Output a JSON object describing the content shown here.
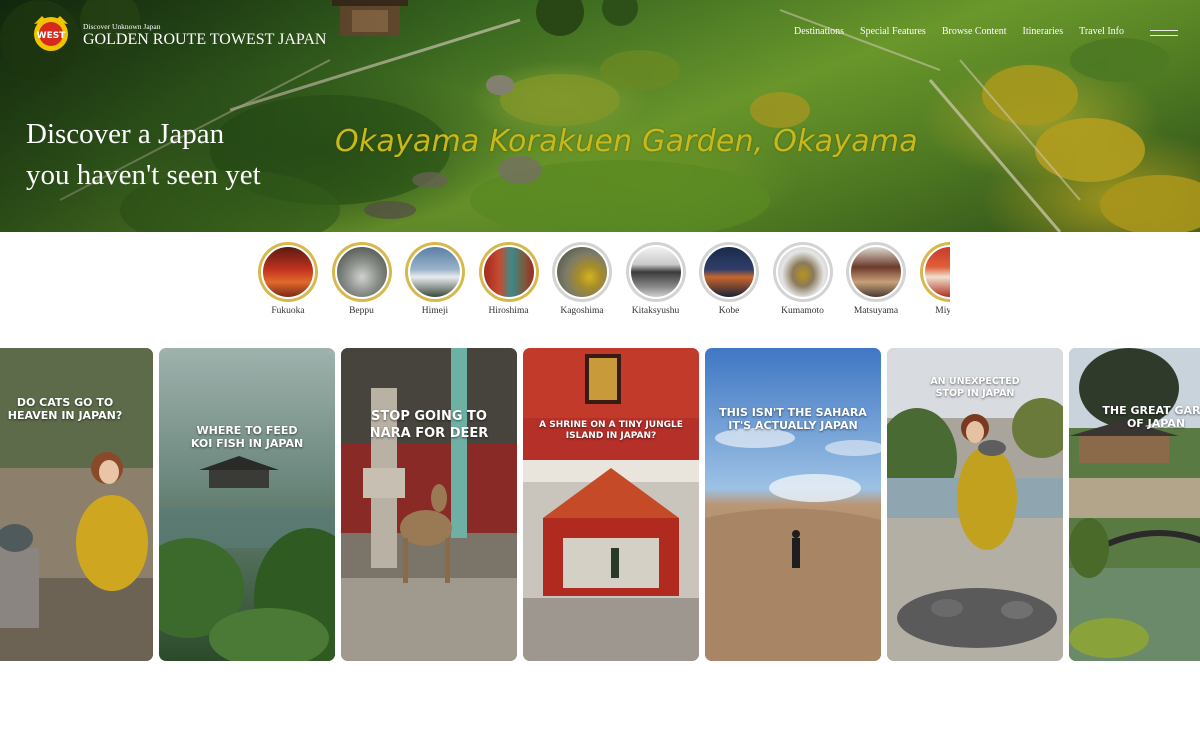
{
  "header": {
    "brand_line1": "Discover Unknown Japan",
    "brand_line2": "GOLDEN ROUTE TO",
    "brand_title": "WEST JAPAN",
    "logo_text": "WEST"
  },
  "nav": {
    "items": [
      "Destinations",
      "Special Features",
      "Browse Content",
      "Itineraries",
      "Travel Info"
    ]
  },
  "hero": {
    "tagline_line1": "Discover a Japan",
    "tagline_line2": "you haven't seen yet",
    "location": "Okayama Korakuen Garden, Okayama"
  },
  "stories": [
    {
      "label": "Fukuoka"
    },
    {
      "label": "Beppu"
    },
    {
      "label": "Himeji"
    },
    {
      "label": "Hiroshima"
    },
    {
      "label": "Kagoshima"
    },
    {
      "label": "Kitaksyushu"
    },
    {
      "label": "Kobe"
    },
    {
      "label": "Kumamoto"
    },
    {
      "label": "Matsuyama"
    },
    {
      "label": "Miyaza"
    }
  ],
  "reels": [
    {
      "caption_1": "DO CATS GO TO",
      "caption_2": "HEAVEN IN JAPAN?"
    },
    {
      "caption_1": "WHERE TO FEED",
      "caption_2": "KOI FISH IN JAPAN"
    },
    {
      "caption_1": "STOP GOING TO",
      "caption_2": "NARA FOR DEER"
    },
    {
      "caption_1": "A SHRINE ON A TINY JUNGLE",
      "caption_2": "ISLAND IN JAPAN?"
    },
    {
      "caption_1": "THIS ISN'T THE SAHARA",
      "caption_2": "IT'S ACTUALLY JAPAN"
    },
    {
      "caption_1": "AN UNEXPECTED",
      "caption_2": "STOP IN JAPAN"
    },
    {
      "caption_1": "THE GREAT GARD",
      "caption_2": "OF JAPAN"
    }
  ],
  "colors": {
    "ring_new": "#d6b84c",
    "ring_seen": "#d3d3d3",
    "location_text": "#c9b817"
  }
}
